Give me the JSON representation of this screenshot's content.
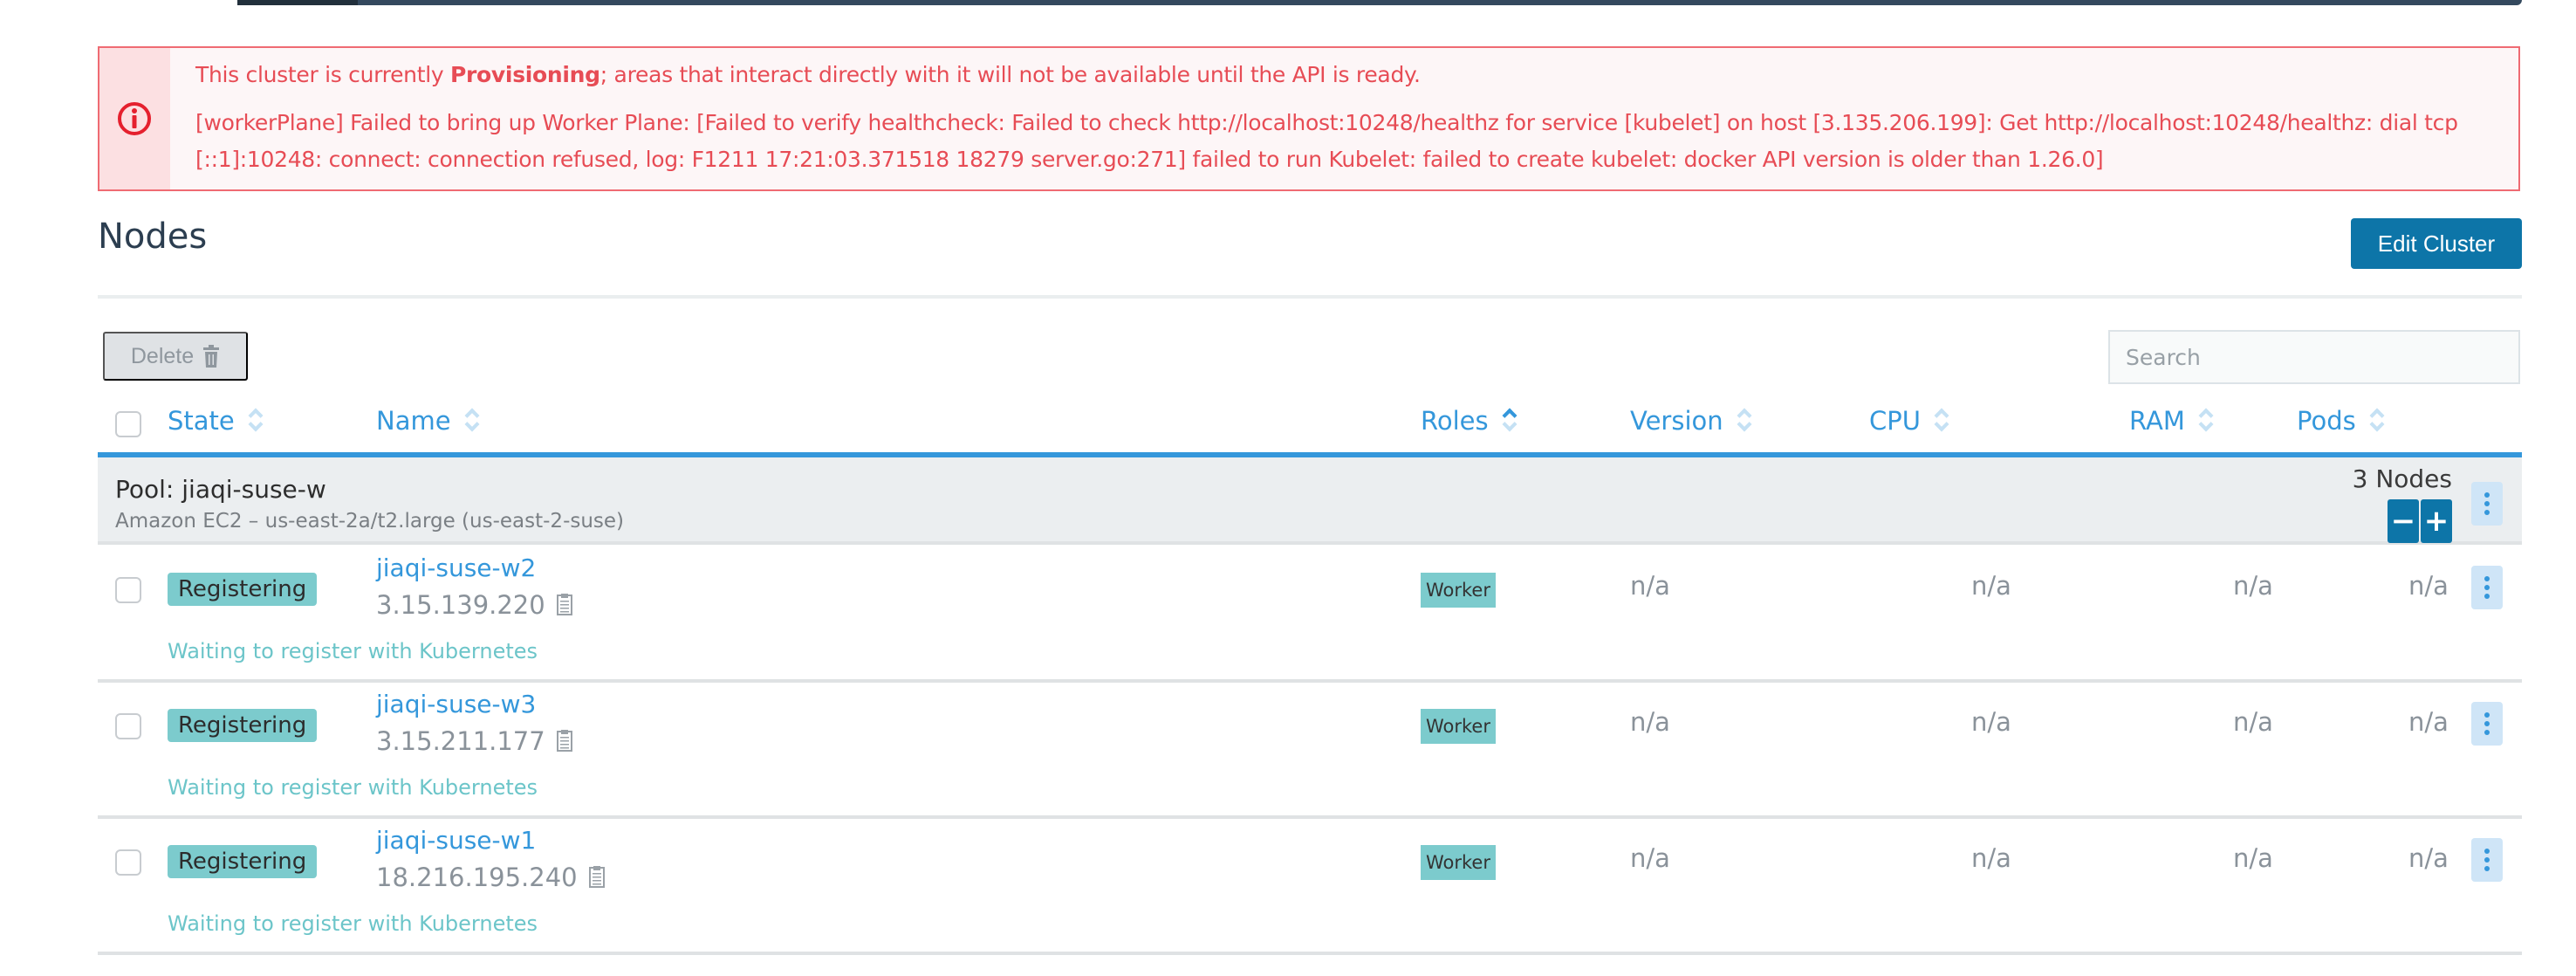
{
  "alert": {
    "icon": "info-circle-icon",
    "line1_prefix": "This cluster is currently ",
    "line1_bold": "Provisioning",
    "line1_suffix": "; areas that interact directly with it will not be available until the API is ready.",
    "line2": "[workerPlane] Failed to bring up Worker Plane: [Failed to verify healthcheck: Failed to check http://localhost:10248/healthz for service [kubelet] on host [3.135.206.199]: Get http://localhost:10248/healthz: dial tcp",
    "line3": "[::1]:10248: connect: connection refused, log: F1211 17:21:03.371518 18279 server.go:271] failed to run Kubelet: failed to create kubelet: docker API version is older than 1.26.0]"
  },
  "page": {
    "title": "Nodes",
    "edit_button": "Edit Cluster"
  },
  "toolbar": {
    "delete_label": "Delete",
    "search_placeholder": "Search",
    "search_value": ""
  },
  "table": {
    "columns": [
      {
        "label": "State",
        "sort": "none"
      },
      {
        "label": "Name",
        "sort": "none"
      },
      {
        "label": "Roles",
        "sort": "asc"
      },
      {
        "label": "Version",
        "sort": "none"
      },
      {
        "label": "CPU",
        "sort": "none"
      },
      {
        "label": "RAM",
        "sort": "none"
      },
      {
        "label": "Pods",
        "sort": "none"
      }
    ],
    "pool": {
      "name": "Pool: jiaqi-suse-w",
      "description": "Amazon EC2 – us-east-2a/t2.large (us-east-2-suse)",
      "count_label": "3 Nodes",
      "decrease_label": "−",
      "increase_label": "+"
    },
    "rows": [
      {
        "state": "Registering",
        "name": "jiaqi-suse-w2",
        "ip": "3.15.139.220",
        "message": "Waiting to register with Kubernetes",
        "role": "Worker",
        "version": "n/a",
        "cpu": "n/a",
        "ram": "n/a",
        "pods": "n/a"
      },
      {
        "state": "Registering",
        "name": "jiaqi-suse-w3",
        "ip": "3.15.211.177",
        "message": "Waiting to register with Kubernetes",
        "role": "Worker",
        "version": "n/a",
        "cpu": "n/a",
        "ram": "n/a",
        "pods": "n/a"
      },
      {
        "state": "Registering",
        "name": "jiaqi-suse-w1",
        "ip": "18.216.195.240",
        "message": "Waiting to register with Kubernetes",
        "role": "Worker",
        "version": "n/a",
        "cpu": "n/a",
        "ram": "n/a",
        "pods": "n/a"
      }
    ]
  },
  "colors": {
    "accent": "#3497db",
    "primary_button": "#0d75a8",
    "error": "#e74c55",
    "state_badge": "#7ccbcd"
  }
}
